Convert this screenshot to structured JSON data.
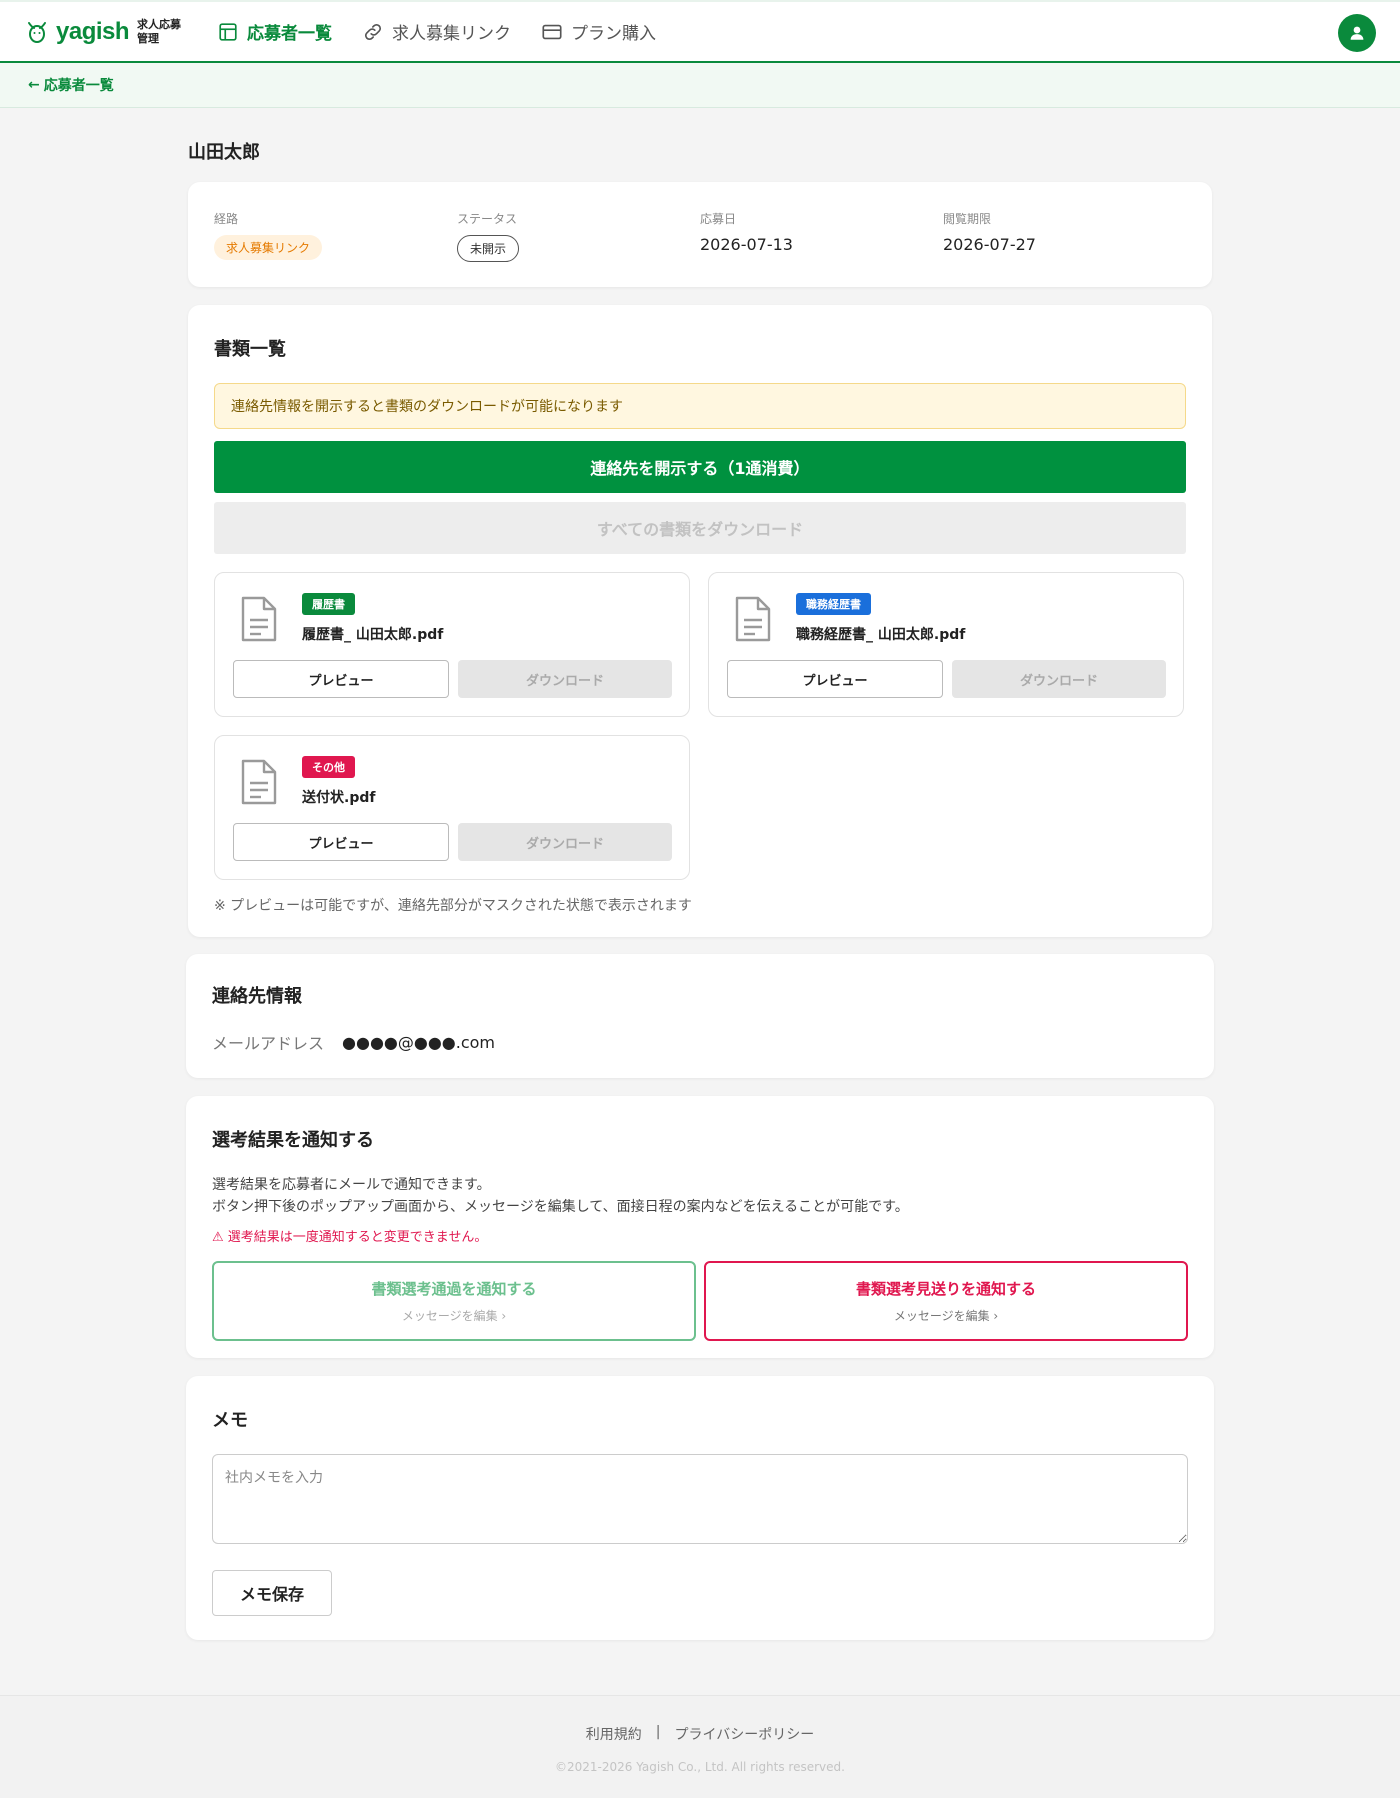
{
  "header": {
    "logo_word": "yagish",
    "logo_sub_line1": "求人応募",
    "logo_sub_line2": "管理",
    "nav": [
      {
        "label": "応募者一覧",
        "icon": "table-icon",
        "active": true
      },
      {
        "label": "求人募集リンク",
        "icon": "link-icon",
        "active": false
      },
      {
        "label": "プラン購入",
        "icon": "credit-card-icon",
        "active": false
      }
    ],
    "avatar_icon": "user-icon",
    "accent": "#0a8a3c"
  },
  "subbar": {
    "back_label": "応募者一覧"
  },
  "applicant": {
    "name": "山田太郎",
    "meta": [
      {
        "label": "経路",
        "value": "求人募集リンク"
      },
      {
        "label": "ステータス",
        "value": "未開示"
      },
      {
        "label": "応募日",
        "value": "2026-07-13"
      },
      {
        "label": "閲覧期限",
        "value": "2026-07-27"
      }
    ]
  },
  "documents": {
    "title": "書類一覧",
    "notice": "連絡先情報を開示すると書類のダウンロードが可能になります",
    "reveal_button": "連絡先を開示する（1通消費）",
    "download_all_button": "すべての書類をダウンロード",
    "items": [
      {
        "tag": "履歴書",
        "tag_color": "#0a8a3c",
        "filename": "履歴書_ 山田太郎.pdf",
        "preview": "プレビュー",
        "download": "ダウンロード"
      },
      {
        "tag": "職務経歴書",
        "tag_color": "#1a6fdb",
        "filename": "職務経歴書_ 山田太郎.pdf",
        "preview": "プレビュー",
        "download": "ダウンロード"
      },
      {
        "tag": "その他",
        "tag_color": "#e0174f",
        "filename": "送付状.pdf",
        "preview": "プレビュー",
        "download": "ダウンロード"
      }
    ],
    "footnote": "※ プレビューは可能ですが、連絡先部分がマスクされた状態で表示されます"
  },
  "contact": {
    "title": "連絡先情報",
    "email_label": "メールアドレス",
    "email_value": "●●●●@●●●.com"
  },
  "result": {
    "title": "選考結果を通知する",
    "desc_line1": "選考結果を応募者にメールで通知できます。",
    "desc_line2": "ボタン押下後のポップアップ画面から、メッセージを編集して、面接日程の案内などを伝えることが可能です。",
    "warning": "⚠ 選考結果は一度通知すると変更できません。",
    "pass_title": "書類選考通過を通知する",
    "pass_sub": "メッセージを編集 ›",
    "reject_title": "書類選考見送りを通知する",
    "reject_sub": "メッセージを編集 ›"
  },
  "memo": {
    "title": "メモ",
    "placeholder": "社内メモを入力",
    "value": "",
    "save_label": "メモ保存"
  },
  "footer": {
    "terms": "利用規約",
    "separator": "|",
    "privacy": "プライバシーポリシー",
    "copyright": "©2021-2026 Yagish Co., Ltd. All rights reserved."
  }
}
